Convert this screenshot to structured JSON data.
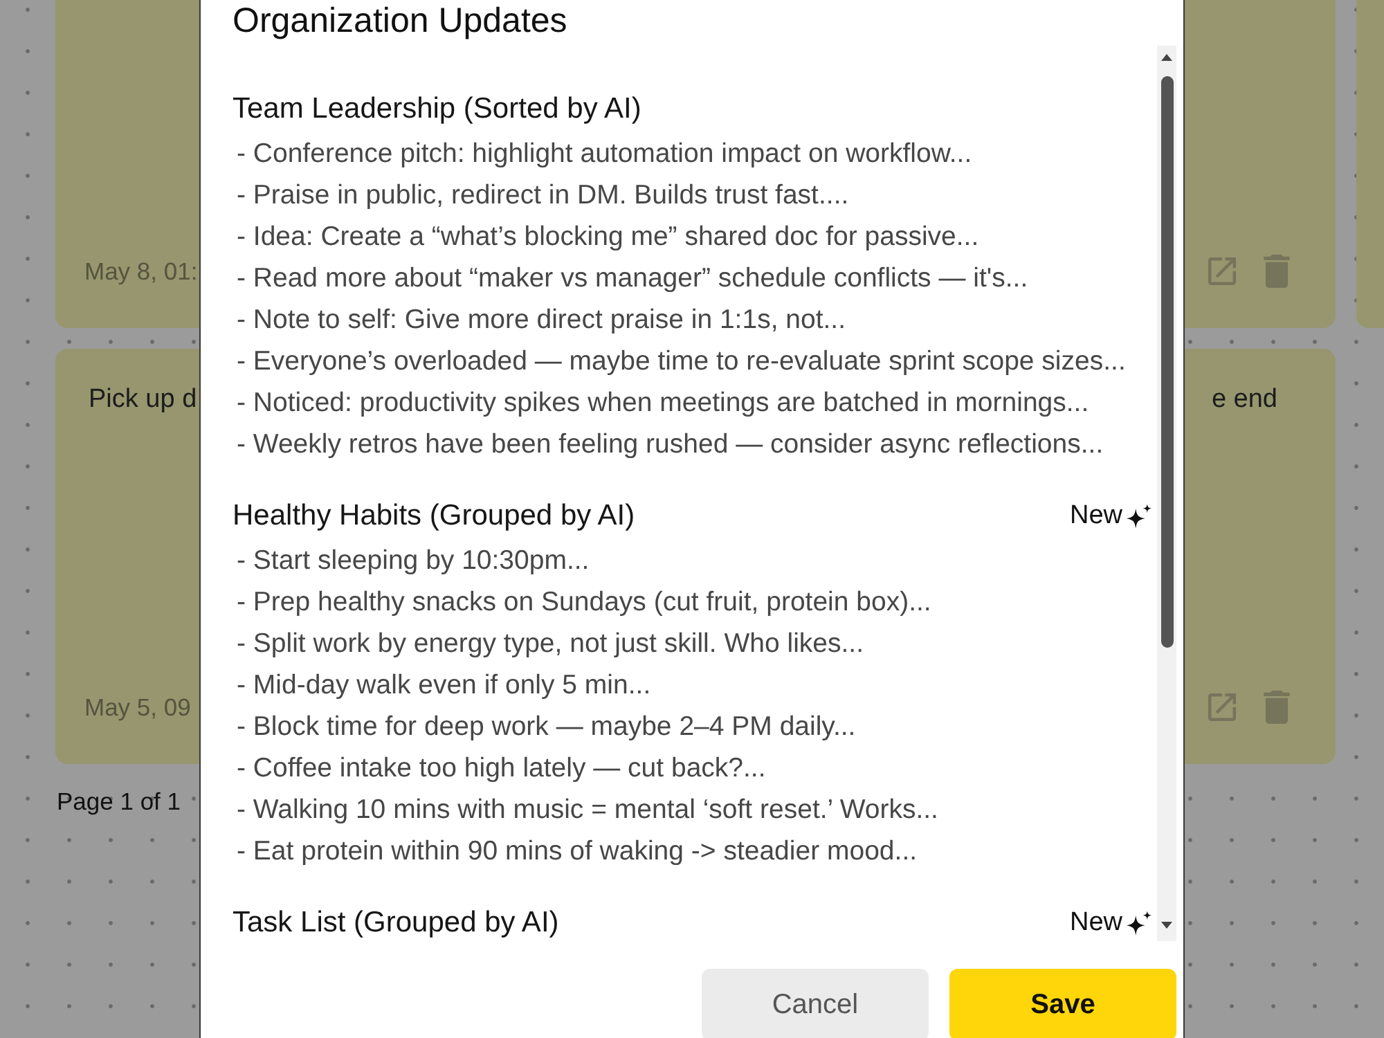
{
  "background": {
    "notes": [
      {
        "date": "May 8, 01:"
      },
      {
        "text_parts": [
          "Pick up d",
          "e end"
        ],
        "date": "May 5, 09"
      }
    ],
    "pagination": "Page 1 of 1"
  },
  "dialog": {
    "title": "Organization Updates",
    "sections": [
      {
        "heading": "Team Leadership (Sorted by AI)",
        "items": [
          "- Conference pitch: highlight automation impact on workflow...",
          "- Praise in public, redirect in DM. Builds trust fast....",
          "- Idea: Create a “what’s blocking me” shared doc for passive...",
          "- Read more about “maker vs manager” schedule conflicts — it's...",
          "- Note to self: Give more direct praise in 1:1s, not...",
          "- Everyone’s overloaded — maybe time to re-evaluate sprint scope sizes...",
          "- Noticed: productivity spikes when meetings are batched in mornings...",
          "- Weekly retros have been feeling rushed — consider async reflections..."
        ]
      },
      {
        "heading": "Healthy Habits (Grouped by AI)",
        "badge": "New",
        "items": [
          "- Start sleeping by 10:30pm...",
          "- Prep healthy snacks on Sundays (cut fruit, protein box)...",
          "- Split work by energy type, not just skill. Who likes...",
          "- Mid-day walk even if only 5 min...",
          "- Block time for deep work — maybe 2–4 PM daily...",
          "- Coffee intake too high lately — cut back?...",
          "- Walking 10 mins with music = mental ‘soft reset.’ Works...",
          "- Eat protein within 90 mins of waking -> steadier mood..."
        ]
      },
      {
        "heading": "Task List (Grouped by AI)",
        "badge": "New"
      }
    ],
    "buttons": [
      {
        "label": "Cancel",
        "kind": "secondary"
      },
      {
        "label": "Save",
        "kind": "primary"
      }
    ]
  }
}
